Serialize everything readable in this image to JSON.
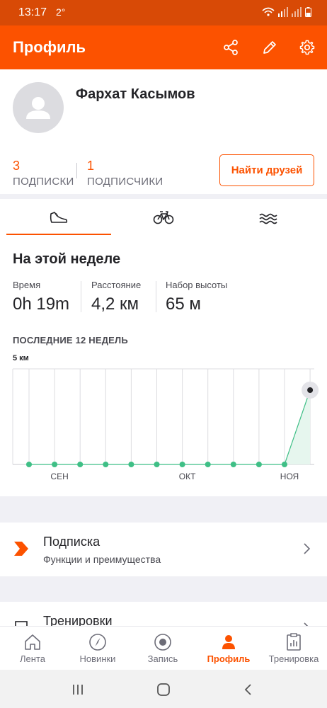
{
  "status_bar": {
    "time": "13:17",
    "extra": "2°"
  },
  "app_bar": {
    "title": "Профиль"
  },
  "profile": {
    "name": "Фархат Касымов",
    "following_count": "3",
    "following_label": "ПОДПИСКИ",
    "followers_count": "1",
    "followers_label": "ПОДПИСЧИКИ",
    "find_friends_label": "Найти друзей"
  },
  "sport_tabs": [
    {
      "icon": "run-shoe-icon",
      "selected": true
    },
    {
      "icon": "bicycle-icon",
      "selected": false
    },
    {
      "icon": "swim-waves-icon",
      "selected": false
    }
  ],
  "this_week": {
    "title": "На этой неделе",
    "metrics": [
      {
        "label": "Время",
        "value": "0h 19m"
      },
      {
        "label": "Расстояние",
        "value": "4,2 км"
      },
      {
        "label": "Набор высоты",
        "value": "65 м"
      }
    ]
  },
  "chart_heading": "ПОСЛЕДНИЕ 12 НЕДЕЛЬ",
  "chart_data": {
    "type": "area",
    "ylabel": "5 км",
    "ylim": [
      0,
      5
    ],
    "x": [
      1,
      2,
      3,
      4,
      5,
      6,
      7,
      8,
      9,
      10,
      11,
      12
    ],
    "values": [
      0,
      0,
      0,
      0,
      0,
      0,
      0,
      0,
      0,
      0,
      0,
      4.2
    ],
    "tick_labels": [
      {
        "week": 2,
        "label": "СЕН"
      },
      {
        "week": 7,
        "label": "ОКТ"
      },
      {
        "week": 11,
        "label": "НОЯ"
      }
    ],
    "colors": {
      "line": "#3fbf86",
      "fill": "#e6f6ee",
      "highlight": "#242428"
    }
  },
  "subscription": {
    "title": "Подписка",
    "description": "Функции и преимущества"
  },
  "trainings": {
    "title": "Тренировки"
  },
  "bottom_nav": [
    {
      "label": "Лента",
      "icon": "home-icon",
      "active": false
    },
    {
      "label": "Новинки",
      "icon": "compass-icon",
      "active": false
    },
    {
      "label": "Запись",
      "icon": "record-icon",
      "active": false
    },
    {
      "label": "Профиль",
      "icon": "person-icon",
      "active": true
    },
    {
      "label": "Тренировка",
      "icon": "clipboard-chart-icon",
      "active": false
    }
  ],
  "colors": {
    "brand": "#fc5200",
    "status_bar": "#d84a06",
    "text": "#242428",
    "muted": "#6d6d78",
    "section_gap": "#f0f0f5"
  }
}
